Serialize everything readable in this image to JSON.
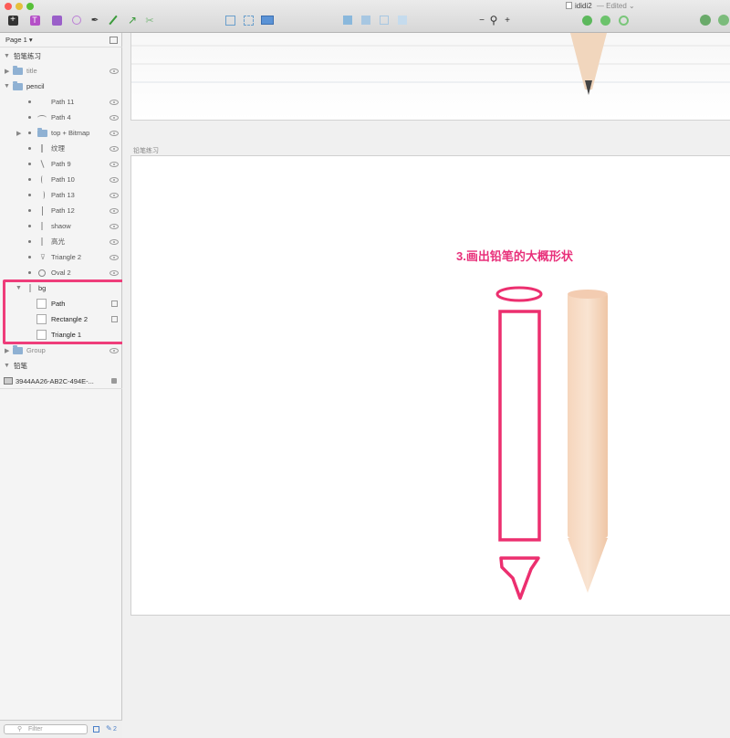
{
  "window": {
    "title": "ididi2",
    "status": "— Edited ⌄"
  },
  "sidebar": {
    "page_selector": "Page 1 ▾",
    "sections": [
      {
        "label": "铅笔练习"
      },
      {
        "label": "铅笔"
      }
    ],
    "layers": {
      "title": "title",
      "pencil": "pencil",
      "path11": "Path 11",
      "path4": "Path 4",
      "top_bitmap": "top + Bitmap",
      "wenli": "纹理",
      "path9": "Path 9",
      "path10": "Path 10",
      "path13": "Path 13",
      "path12": "Path 12",
      "shaow": "shaow",
      "gaoguang": "高光",
      "triangle2": "Triangle 2",
      "oval2": "Oval 2",
      "bg": "bg",
      "path": "Path",
      "rectangle2": "Rectangle 2",
      "triangle1": "Triangle 1",
      "group": "Group",
      "bitmap_id": "3944AA26-AB2C-494E-..."
    },
    "filter_placeholder": "Filter",
    "footer_count": "2"
  },
  "canvas": {
    "artboard_label": "铅笔练习",
    "heading": "3.画出铅笔的大概形状"
  },
  "colors": {
    "accent": "#ee3d7a",
    "pencil_wood": "#f7dcc5"
  }
}
